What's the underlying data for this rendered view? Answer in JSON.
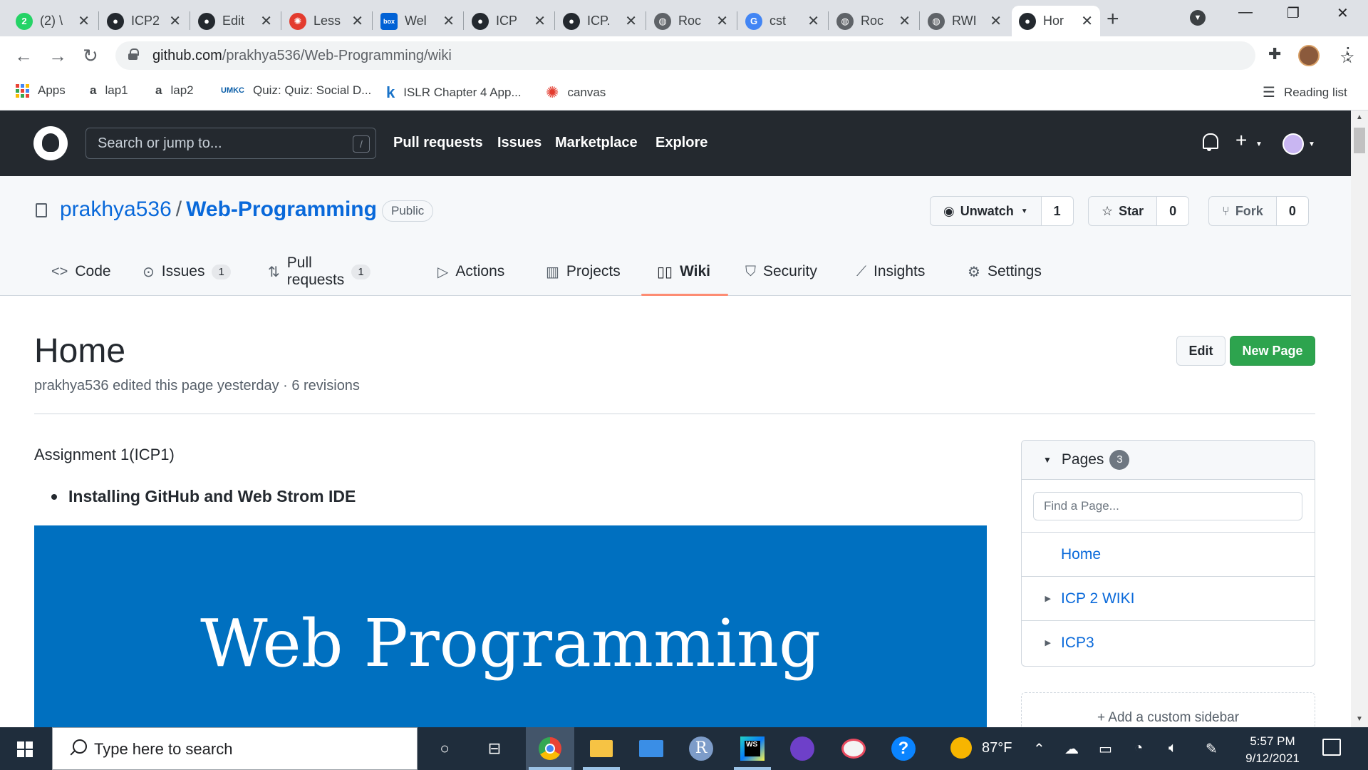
{
  "browser": {
    "tabs": [
      {
        "title": "(2) \\",
        "icon": "whatsapp-icon",
        "color": "#25d366",
        "glyph": "2"
      },
      {
        "title": "ICP2",
        "icon": "github-icon",
        "color": "#24292f",
        "glyph": "●"
      },
      {
        "title": "Edit",
        "icon": "github-icon",
        "color": "#24292f",
        "glyph": "●"
      },
      {
        "title": "Less",
        "icon": "canvas-icon",
        "color": "#e33b2e",
        "glyph": "✺"
      },
      {
        "title": "Wel",
        "icon": "box-icon",
        "color": "#0061d5",
        "glyph": "box"
      },
      {
        "title": "ICP",
        "icon": "github-icon",
        "color": "#24292f",
        "glyph": "●"
      },
      {
        "title": "ICP.",
        "icon": "github-icon",
        "color": "#24292f",
        "glyph": "●"
      },
      {
        "title": "Roc",
        "icon": "globe-icon",
        "color": "#5f6368",
        "glyph": "◍"
      },
      {
        "title": "cst",
        "icon": "google-icon",
        "color": "#4285f4",
        "glyph": "G"
      },
      {
        "title": "Roc",
        "icon": "globe-icon",
        "color": "#5f6368",
        "glyph": "◍"
      },
      {
        "title": "RWI",
        "icon": "globe-icon",
        "color": "#5f6368",
        "glyph": "◍"
      },
      {
        "title": "Hor",
        "icon": "github-icon",
        "color": "#24292f",
        "glyph": "●",
        "active": true
      }
    ],
    "url_host": "github.com",
    "url_path": "/prakhya536/Web-Programming/wiki",
    "bookmarks": [
      {
        "label": "Apps",
        "icon": "apps-grid-icon"
      },
      {
        "label": "lap1",
        "icon": "amazon-icon",
        "glyph": "a"
      },
      {
        "label": "lap2",
        "icon": "amazon-icon",
        "glyph": "a"
      },
      {
        "label": "Quiz: Quiz: Social D...",
        "icon": "umkc-icon",
        "glyph": "UMKC"
      },
      {
        "label": "ISLR Chapter 4 App...",
        "icon": "k-icon",
        "glyph": "k"
      },
      {
        "label": "canvas",
        "icon": "canvas-icon",
        "glyph": "✺"
      }
    ],
    "reading_list": "Reading list"
  },
  "github": {
    "search_placeholder": "Search or jump to...",
    "search_shortcut": "/",
    "nav": [
      "Pull requests",
      "Issues",
      "Marketplace",
      "Explore"
    ],
    "repo_owner": "prakhya536",
    "repo_separator": "/",
    "repo_name": "Web-Programming",
    "visibility": "Public",
    "actions": [
      {
        "label": "Unwatch",
        "count": "1",
        "icon": "eye-icon"
      },
      {
        "label": "Star",
        "count": "0",
        "icon": "star-icon"
      },
      {
        "label": "Fork",
        "count": "0",
        "icon": "fork-icon"
      }
    ],
    "tabs": [
      {
        "label": "Code",
        "icon": "code-icon",
        "glyph": "<>"
      },
      {
        "label": "Issues",
        "icon": "issue-icon",
        "glyph": "⊙",
        "count": "1"
      },
      {
        "label": "Pull requests",
        "icon": "pull-request-icon",
        "glyph": "⇅",
        "count": "1"
      },
      {
        "label": "Actions",
        "icon": "play-icon",
        "glyph": "▷"
      },
      {
        "label": "Projects",
        "icon": "project-icon",
        "glyph": "▥"
      },
      {
        "label": "Wiki",
        "icon": "book-icon",
        "glyph": "📖",
        "active": true
      },
      {
        "label": "Security",
        "icon": "shield-icon",
        "glyph": "⛉"
      },
      {
        "label": "Insights",
        "icon": "graph-icon",
        "glyph": "📈"
      },
      {
        "label": "Settings",
        "icon": "gear-icon",
        "glyph": "⚙"
      }
    ]
  },
  "wiki": {
    "title": "Home",
    "meta": "prakhya536 edited this page yesterday · 6 revisions",
    "edit_label": "Edit",
    "new_page_label": "New Page",
    "assignment": "Assignment 1(ICP1)",
    "bullet": "Installing GitHub and Web Strom IDE",
    "banner_text": "Web Programming",
    "banner_color": "#0070c0"
  },
  "sidebar": {
    "header": "Pages",
    "count": "3",
    "find_placeholder": "Find a Page...",
    "pages": [
      {
        "label": "Home",
        "expandable": false
      },
      {
        "label": "ICP 2 WIKI",
        "expandable": true
      },
      {
        "label": "ICP3",
        "expandable": true
      }
    ],
    "custom_sidebar": "+ Add a custom sidebar"
  },
  "taskbar": {
    "search_placeholder": "Type here to search",
    "weather": "87°F",
    "time": "5:57 PM",
    "date": "9/12/2021",
    "apps": [
      "cortana-icon",
      "task-view-icon",
      "chrome-icon",
      "file-explorer-icon",
      "mail-icon",
      "r-icon",
      "webstorm-icon",
      "github-desktop-icon",
      "paint-icon",
      "help-icon"
    ]
  }
}
